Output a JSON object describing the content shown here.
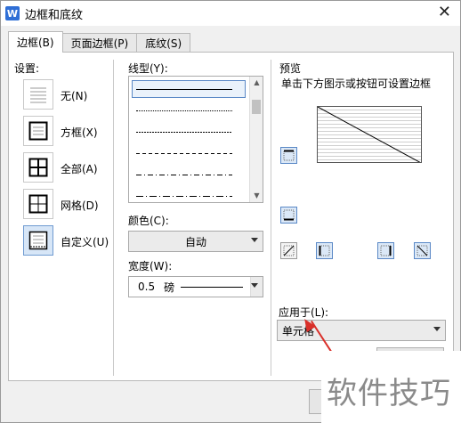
{
  "window": {
    "title": "边框和底纹",
    "app_icon": "W",
    "close_glyph": "✕"
  },
  "tabs": [
    {
      "label": "边框(B)",
      "active": true
    },
    {
      "label": "页面边框(P)",
      "active": false
    },
    {
      "label": "底纹(S)",
      "active": false
    }
  ],
  "settings": {
    "header": "设置:",
    "items": [
      {
        "label": "无(N)",
        "icon": "none-border-icon"
      },
      {
        "label": "方框(X)",
        "icon": "box-border-icon"
      },
      {
        "label": "全部(A)",
        "icon": "all-borders-icon"
      },
      {
        "label": "网格(D)",
        "icon": "grid-border-icon"
      },
      {
        "label": "自定义(U)",
        "icon": "custom-border-icon",
        "selected": true
      }
    ]
  },
  "line_style": {
    "header": "线型(Y):",
    "styles": [
      "solid",
      "dotted",
      "dashed-fine",
      "dashed",
      "dash-dot",
      "dash-dot-long"
    ]
  },
  "color": {
    "label": "颜色(C):",
    "value": "自动"
  },
  "width": {
    "label": "宽度(W):",
    "value": "0.5",
    "unit": "磅"
  },
  "preview": {
    "header": "预览",
    "hint": "单击下方图示或按钮可设置边框"
  },
  "apply_to": {
    "label": "应用于(L):",
    "value": "单元格"
  },
  "watermark": "软件技巧",
  "colors": {
    "selected_bg": "#d7e6f7",
    "preview_btn_border": "#5a88c6",
    "arrow": "#d9302a"
  }
}
